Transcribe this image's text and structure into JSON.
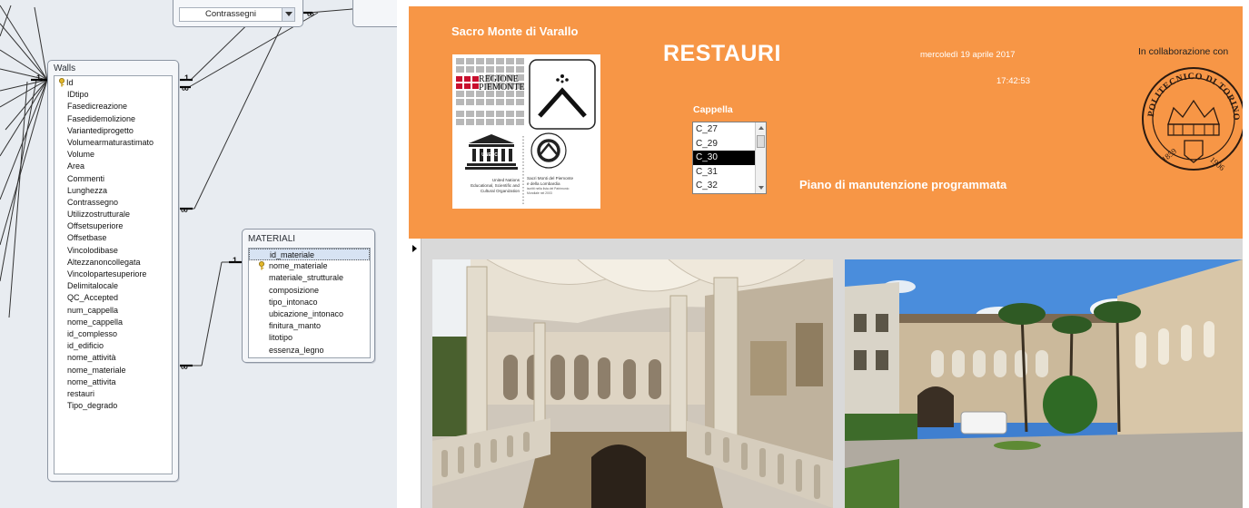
{
  "relationships": {
    "contrassegni_table": {
      "combo_value": "Contrassegni"
    },
    "walls_table": {
      "title": "Walls",
      "fields": [
        "Id",
        "IDtipo",
        "Fasedicreazione",
        "Fasedidemolizione",
        "Variantediprogetto",
        "Volumearmaturastimato",
        "Volume",
        "Area",
        "Commenti",
        "Lunghezza",
        "Contrassegno",
        "Utilizzostrutturale",
        "Offsetsuperiore",
        "Offsetbase",
        "Vincolodibase",
        "Altezzanoncollegata",
        "Vincolopartesuperiore",
        "Delimitalocale",
        "QC_Accepted",
        "num_cappella",
        "nome_cappella",
        "id_complesso",
        "id_edificio",
        "nome_attività",
        "nome_materiale",
        "nome_attivita",
        "restauri",
        "Tipo_degrado"
      ]
    },
    "materiali_table": {
      "title": "MATERIALI",
      "fields": [
        "id_materiale",
        "nome_materiale",
        "materiale_strutturale",
        "composizione",
        "tipo_intonaco",
        "ubicazione_intonaco",
        "finitura_manto",
        "litotipo",
        "essenza_legno"
      ]
    },
    "cardinality": {
      "one": "1",
      "many": "∞"
    }
  },
  "form": {
    "site_title": "Sacro Monte di Varallo",
    "title": "RESTAURI",
    "date": "mercoledì 19 aprile 2017",
    "time": "17:42:53",
    "collaboration": "In collaborazione con",
    "cappella_label": "Cappella",
    "cappella_options": [
      "C_27",
      "C_29",
      "C_30",
      "C_31",
      "C_32"
    ],
    "cappella_selected": "C_30",
    "subtitle": "Piano di manutenzione programmata",
    "logos": {
      "regione_line1": "REGIONE",
      "regione_line2": "PIEMONTE",
      "unesco": "UNESCO",
      "unesco_caption": "United Nations Educational, Scientific and Cultural Organization",
      "sacri_monti_caption": "Sacri Monti del Piemonte e della Lombardia",
      "sacri_monti_small": "iscritti nella lista del Patrimonio Mondiale nel 2003"
    },
    "seal": {
      "text_top": "POLITECNICO DI TORINO",
      "year_left": "1859",
      "year_right": "1906"
    },
    "colors": {
      "header": "#f79646",
      "background": "#d9d9d9"
    }
  }
}
